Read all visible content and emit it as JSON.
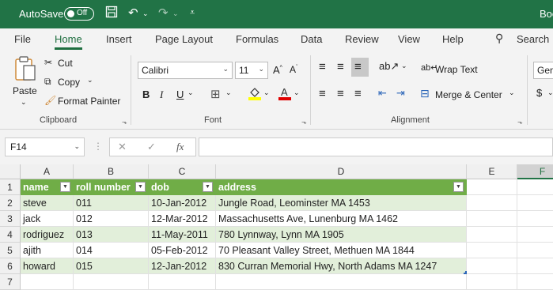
{
  "titlebar": {
    "autosave_label": "AutoSave",
    "toggle_state": "Off",
    "doc_title": "Boo"
  },
  "tabs": [
    "File",
    "Home",
    "Insert",
    "Page Layout",
    "Formulas",
    "Data",
    "Review",
    "View",
    "Help"
  ],
  "search": {
    "label": "Search"
  },
  "clipboard": {
    "paste": "Paste",
    "cut": "Cut",
    "copy": "Copy",
    "format_painter": "Format Painter",
    "group_label": "Clipboard"
  },
  "font": {
    "name": "Calibri",
    "size": "11",
    "group_label": "Font"
  },
  "alignment": {
    "wrap_text": "Wrap Text",
    "merge_center": "Merge & Center",
    "group_label": "Alignment"
  },
  "number": {
    "format": "Gen"
  },
  "formula_bar": {
    "name_box": "F14",
    "fx": "fx",
    "value": ""
  },
  "columns": [
    "A",
    "B",
    "C",
    "D",
    "E",
    "F"
  ],
  "rows": [
    "1",
    "2",
    "3",
    "4",
    "5",
    "6",
    "7"
  ],
  "table": {
    "headers": [
      "name",
      "roll number",
      "dob",
      "address"
    ],
    "data": [
      [
        "steve",
        "011",
        "10-Jan-2012",
        "Jungle Road, Leominster MA 1453"
      ],
      [
        "jack",
        "012",
        "12-Mar-2012",
        "Massachusetts Ave, Lunenburg MA 1462"
      ],
      [
        "rodriguez",
        "013",
        "11-May-2011",
        "780 Lynnway, Lynn MA 1905"
      ],
      [
        "ajith",
        "014",
        "05-Feb-2012",
        "70 Pleasant Valley Street, Methuen MA 1844"
      ],
      [
        "howard",
        "015",
        "12-Jan-2012",
        "830 Curran Memorial Hwy, North Adams MA 1247"
      ]
    ]
  },
  "colors": {
    "brand": "#217346",
    "table_header": "#70ad47",
    "table_band": "#e2efda"
  }
}
